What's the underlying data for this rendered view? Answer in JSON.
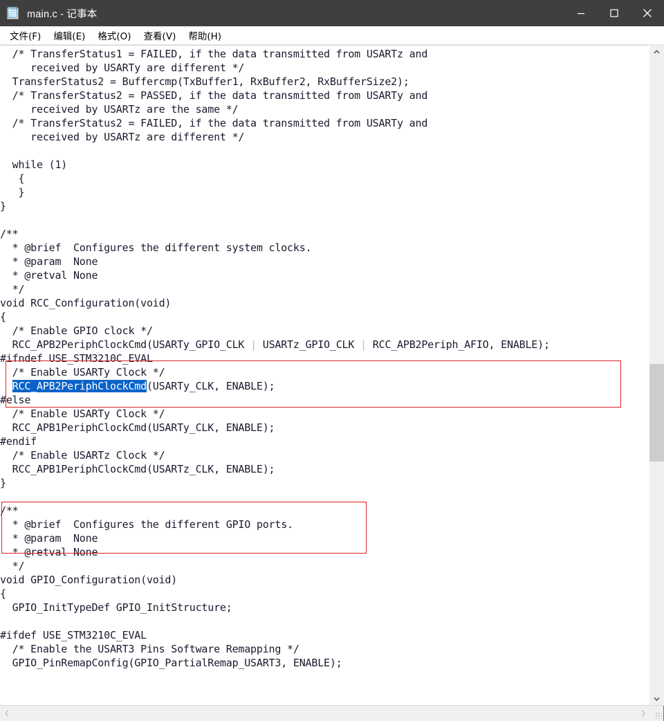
{
  "window": {
    "title": "main.c - 记事本",
    "icon": "notepad-icon",
    "controls": {
      "minimize": "minimize-icon",
      "maximize": "maximize-icon",
      "close": "close-icon"
    },
    "titlebar_color": "#3f3f3f"
  },
  "menubar": {
    "items": [
      {
        "label": "文件(F)"
      },
      {
        "label": "编辑(E)"
      },
      {
        "label": "格式(O)"
      },
      {
        "label": "查看(V)"
      },
      {
        "label": "帮助(H)"
      }
    ]
  },
  "editor": {
    "font": "monospace",
    "selection_color": "#0a63c8",
    "selection_text": "RCC_APB2PeriphClockCmd",
    "annotation_color": "#e02020",
    "lines": [
      "  /* TransferStatus1 = FAILED, if the data transmitted from USARTz and",
      "     received by USARTy are different */",
      "  TransferStatus2 = Buffercmp(TxBuffer1, RxBuffer2, RxBufferSize2);",
      "  /* TransferStatus2 = PASSED, if the data transmitted from USARTy and",
      "     received by USARTz are the same */",
      "  /* TransferStatus2 = FAILED, if the data transmitted from USARTy and",
      "     received by USARTz are different */",
      "",
      "  while (1)",
      "   {",
      "   }",
      "}",
      "",
      "/**",
      "  * @brief  Configures the different system clocks.",
      "  * @param  None",
      "  * @retval None",
      "  */",
      "void RCC_Configuration(void)",
      "{",
      "  /* Enable GPIO clock */",
      "  RCC_APB2PeriphClockCmd(USARTy_GPIO_CLK | USARTz_GPIO_CLK | RCC_APB2Periph_AFIO, ENABLE);",
      "#ifndef USE_STM3210C_EVAL",
      "  /* Enable USARTy Clock */",
      "  RCC_APB2PeriphClockCmd(USARTy_CLK, ENABLE);",
      "#else",
      "  /* Enable USARTy Clock */",
      "  RCC_APB1PeriphClockCmd(USARTy_CLK, ENABLE);",
      "#endif",
      "  /* Enable USARTz Clock */",
      "  RCC_APB1PeriphClockCmd(USARTz_CLK, ENABLE);",
      "}",
      "",
      "/**",
      "  * @brief  Configures the different GPIO ports.",
      "  * @param  None",
      "  * @retval None",
      "  */",
      "void GPIO_Configuration(void)",
      "{",
      "  GPIO_InitTypeDef GPIO_InitStructure;",
      "",
      "#ifdef USE_STM3210C_EVAL",
      "  /* Enable the USART3 Pins Software Remapping */",
      "  GPIO_PinRemapConfig(GPIO_PartialRemap_USART3, ENABLE);"
    ]
  },
  "scrollbars": {
    "vertical": {
      "up_arrow": "chevron-up-icon",
      "down_arrow": "chevron-down-icon"
    },
    "horizontal": {
      "left_arrow": "chevron-left-icon",
      "right_arrow": "chevron-right-icon",
      "resize_grip": "resize-grip-icon"
    }
  }
}
